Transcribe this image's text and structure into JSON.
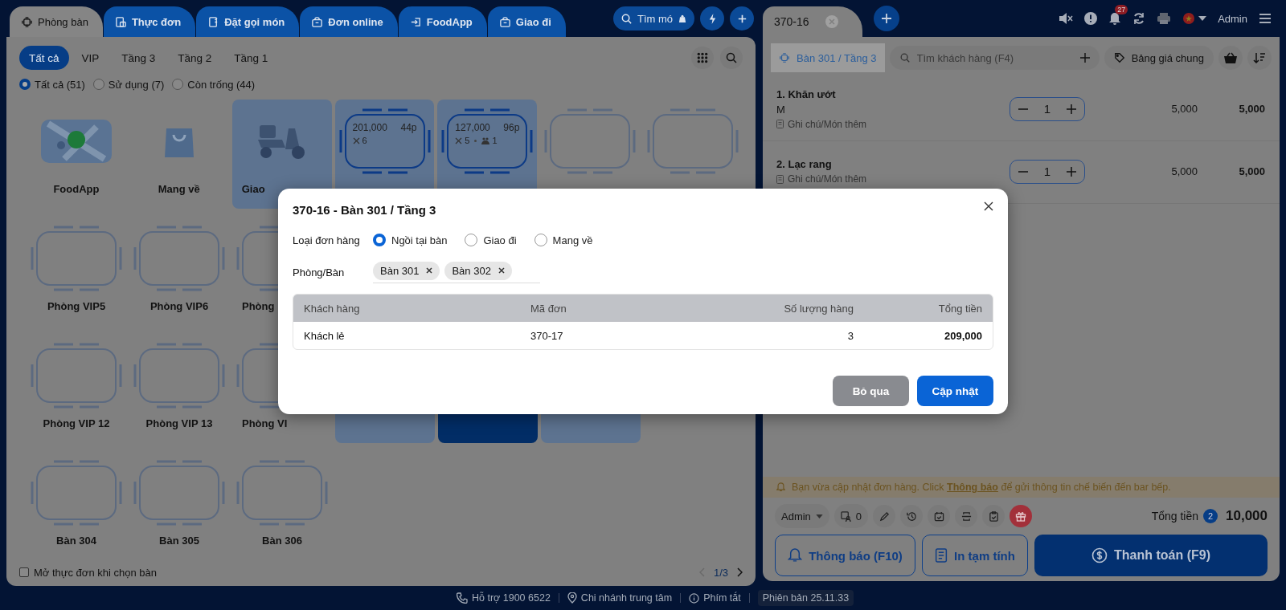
{
  "left_tabs": [
    {
      "kind": "tables",
      "label": "Phòng bàn",
      "selected": true
    },
    {
      "kind": "menu",
      "label": "Thực đơn",
      "selected": false
    },
    {
      "kind": "order",
      "label": "Đặt gọi món",
      "selected": false
    },
    {
      "kind": "online",
      "label": "Đơn online",
      "selected": false
    },
    {
      "kind": "foodapp",
      "label": "FoodApp",
      "selected": false
    },
    {
      "kind": "delivery",
      "label": "Giao đi",
      "selected": false
    }
  ],
  "quick_search": "Tìm mó",
  "areas": [
    {
      "label": "Tất cả",
      "selected": true
    },
    {
      "label": "VIP",
      "selected": false
    },
    {
      "label": "Tầng 3",
      "selected": false
    },
    {
      "label": "Tầng 2",
      "selected": false
    },
    {
      "label": "Tầng 1",
      "selected": false
    }
  ],
  "status_filters": [
    {
      "label": "Tất cả (51)",
      "selected": true
    },
    {
      "label": "Sử dụng (7)",
      "selected": false
    },
    {
      "label": "Còn trống (44)",
      "selected": false
    }
  ],
  "tile_rows": [
    [
      {
        "kind": "foodapp",
        "label": "FoodApp",
        "occupied": false,
        "selected": false
      },
      {
        "kind": "takeaway",
        "label": "Mang về",
        "occupied": false,
        "selected": false
      },
      {
        "kind": "delivery",
        "label": "Giao",
        "occupied": true,
        "selected": false
      },
      {
        "kind": "table",
        "occupied": true,
        "selected": false,
        "amount": "201,000",
        "duration": "44p",
        "dishes": "6"
      },
      {
        "kind": "table",
        "occupied": true,
        "selected": false,
        "amount": "127,000",
        "duration": "96p",
        "dishes": "5",
        "guests": "1"
      },
      {
        "kind": "table",
        "occupied": false,
        "selected": false
      },
      {
        "kind": "table",
        "occupied": false,
        "selected": false
      }
    ],
    [
      {
        "kind": "table",
        "label": "Phòng VIP5",
        "occupied": false,
        "selected": false
      },
      {
        "kind": "table",
        "label": "Phòng VIP6",
        "occupied": false,
        "selected": false
      },
      {
        "kind": "table",
        "label": "Phòng",
        "occupied": false,
        "selected": false
      }
    ],
    [
      {
        "kind": "table",
        "label": "Phòng VIP 12",
        "occupied": false,
        "selected": false
      },
      {
        "kind": "table",
        "label": "Phòng VIP 13",
        "occupied": false,
        "selected": false
      },
      {
        "kind": "table",
        "label": "Phòng VI",
        "occupied": false,
        "selected": false
      },
      {
        "kind": "blank",
        "occupied": true,
        "selected": false
      },
      {
        "kind": "blank",
        "selected": true
      },
      {
        "kind": "blank",
        "occupied": true,
        "selected": false
      }
    ],
    [
      {
        "kind": "table",
        "label": "Bàn 304",
        "occupied": false,
        "selected": false
      },
      {
        "kind": "table",
        "label": "Bàn 305",
        "occupied": false,
        "selected": false
      },
      {
        "kind": "table",
        "label": "Bàn 306",
        "occupied": false,
        "selected": false
      }
    ]
  ],
  "open_menu_option": {
    "label": "Mở thực đơn khi chọn bàn",
    "checked": false
  },
  "pagination": {
    "page": "1/3",
    "prev_disabled": true
  },
  "order_tab": "370-16",
  "notification_count": "27",
  "user": "Admin",
  "table_button": "Bàn 301 / Tầng 3",
  "customer_search": {
    "placeholder": "Tìm khách hàng (F4)"
  },
  "price_list": "Bảng giá chung",
  "items": [
    {
      "name": "1. Khăn ướt",
      "variant": "M",
      "note": "Ghi chú/Món thêm",
      "quantity": "1",
      "price": "5,000",
      "total": "5,000"
    },
    {
      "name": "2. Lạc rang",
      "note": "Ghi chú/Món thêm",
      "quantity": "1",
      "price": "5,000",
      "total": "5,000"
    }
  ],
  "notice": {
    "before": "Bạn vừa cập nhật đơn hàng. Click ",
    "link": "Thông báo",
    "after": " để gửi thông tin chế biến đến bar bếp."
  },
  "staff": "Admin",
  "guest_count": "0",
  "total": {
    "label": "Tổng tiền",
    "count": "2",
    "amount": "10,000"
  },
  "actions": [
    {
      "kind": "notify",
      "label": "Thông báo (F10)"
    },
    {
      "kind": "print",
      "label": "In tạm tính"
    },
    {
      "kind": "pay",
      "label": "Thanh toán (F9)"
    }
  ],
  "footer": [
    {
      "kind": "phone",
      "label": "Hỗ trợ 1900 6522"
    },
    {
      "kind": "location",
      "label": "Chi nhánh trung tâm"
    },
    {
      "kind": "info",
      "label": "Phím tắt"
    },
    {
      "kind": "version",
      "label": "Phiên bản 25.11.33"
    }
  ],
  "dialog": {
    "title": "370-16 - Bàn 301 / Tầng 3",
    "order_type_label": "Loại đơn hàng",
    "order_types": [
      {
        "label": "Ngồi tại bàn",
        "selected": true
      },
      {
        "label": "Giao đi",
        "selected": false
      },
      {
        "label": "Mang về",
        "selected": false
      }
    ],
    "tables_label": "Phòng/Bàn",
    "tables": [
      "Bàn 301",
      "Bàn 302"
    ],
    "columns": [
      "Khách hàng",
      "Mã đơn",
      "Số lượng hàng",
      "Tổng tiền"
    ],
    "rows": [
      [
        "Khách lẻ",
        "370-17",
        "3",
        "209,000"
      ]
    ],
    "buttons": [
      {
        "kind": "cancel",
        "label": "Bỏ qua"
      },
      {
        "kind": "confirm",
        "label": "Cập nhật"
      }
    ]
  }
}
